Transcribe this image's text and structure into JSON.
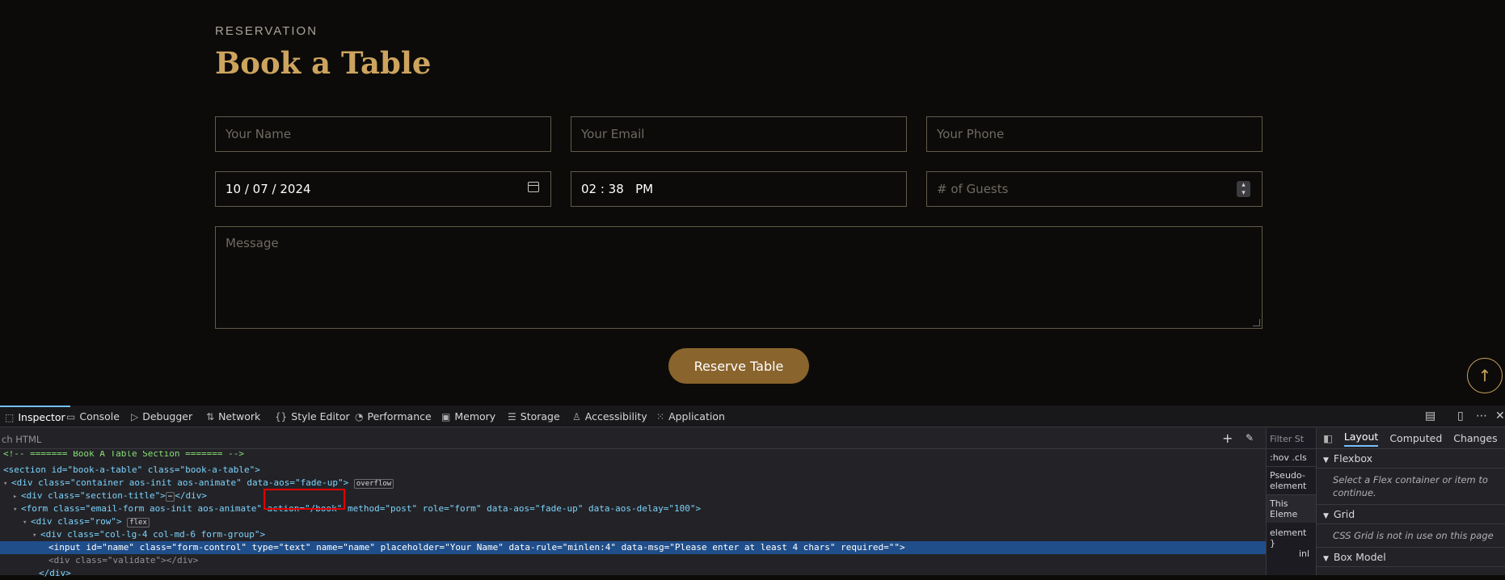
{
  "section": {
    "kicker": "RESERVATION",
    "title": "Book a Table"
  },
  "form": {
    "name_placeholder": "Your Name",
    "email_placeholder": "Your Email",
    "phone_placeholder": "Your Phone",
    "date_value": "10 / 07 / 2024",
    "time_value": "02 : 38   PM",
    "guests_placeholder": "# of Guests",
    "message_placeholder": "Message",
    "submit_label": "Reserve Table"
  },
  "scroll_top_icon": "arrow-up-icon",
  "devtools": {
    "tabs": [
      {
        "label": "Inspector",
        "icon": "inspector-icon"
      },
      {
        "label": "Console",
        "icon": "console-icon"
      },
      {
        "label": "Debugger",
        "icon": "debugger-icon"
      },
      {
        "label": "Network",
        "icon": "network-icon"
      },
      {
        "label": "Style Editor",
        "icon": "style-editor-icon"
      },
      {
        "label": "Performance",
        "icon": "performance-icon"
      },
      {
        "label": "Memory",
        "icon": "memory-icon"
      },
      {
        "label": "Storage",
        "icon": "storage-icon"
      },
      {
        "label": "Accessibility",
        "icon": "accessibility-icon"
      },
      {
        "label": "Application",
        "icon": "application-icon"
      }
    ],
    "search_placeholder": "ch HTML",
    "html_lines": [
      "<!-- ======= Book A Table Section ======= -->",
      "<section id=\"book-a-table\" class=\"book-a-table\">",
      "<div class=\"container aos-init aos-animate\" data-aos=\"fade-up\">",
      "<div class=\"section-title\">",
      "<form class=\"email-form aos-init aos-animate\" action=\"/book\" method=\"post\" role=\"form\" data-aos=\"fade-up\" data-aos-delay=\"100\">",
      "<div class=\"row\">",
      "<div class=\"col-lg-4 col-md-6 form-group\">",
      "<input id=\"name\" class=\"form-control\" type=\"text\" name=\"name\" placeholder=\"Your Name\" data-rule=\"minlen:4\" data-msg=\"Please enter at least 4 chars\" required=\"\">",
      "<div class=\"validate\"></div>",
      "</div>"
    ],
    "badges": {
      "overflow": "overflow",
      "flex": "flex"
    },
    "rules_panel": {
      "filter": "Filter St",
      "hov": ":hov",
      "cls": ".cls",
      "pseudo": "Pseudo-",
      "element": "element",
      "this_element": "This Eleme",
      "element_line": "element",
      "brace": "}",
      "inl": "inl"
    },
    "layout_tabs": [
      "Layout",
      "Computed",
      "Changes"
    ],
    "flexbox": {
      "title": "Flexbox",
      "note": "Select a Flex container or item to continue."
    },
    "grid": {
      "title": "Grid",
      "note": "CSS Grid is not in use on this page"
    },
    "box_model": {
      "title": "Box Model"
    }
  }
}
